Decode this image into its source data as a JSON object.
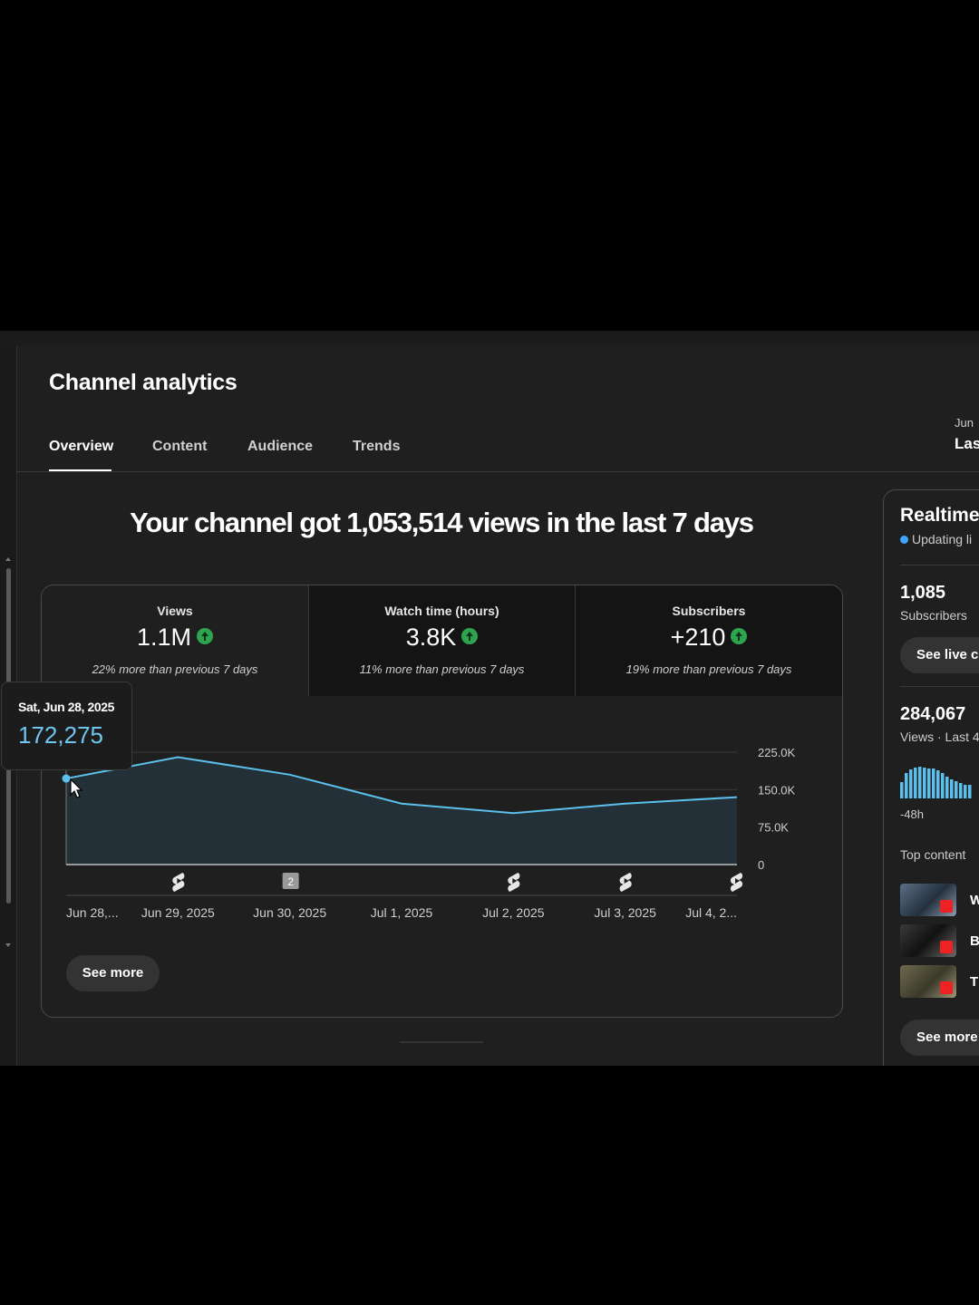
{
  "header": {
    "title": "Channel analytics",
    "tabs": [
      {
        "label": "Overview",
        "active": true
      },
      {
        "label": "Content",
        "active": false
      },
      {
        "label": "Audience",
        "active": false
      },
      {
        "label": "Trends",
        "active": false
      }
    ],
    "date_small": "Jun",
    "date_big": "Las"
  },
  "headline": "Your channel got 1,053,514 views in the last 7 days",
  "metrics": [
    {
      "label": "Views",
      "value": "1.1M",
      "trend": "up",
      "sub": "22% more than previous 7 days"
    },
    {
      "label": "Watch time (hours)",
      "value": "3.8K",
      "trend": "up",
      "sub": "11% more than previous 7 days"
    },
    {
      "label": "Subscribers",
      "value": "+210",
      "trend": "up",
      "sub": "19% more than previous 7 days"
    }
  ],
  "tooltip": {
    "date": "Sat, Jun 28, 2025",
    "value": "172,275"
  },
  "chart_data": {
    "type": "area",
    "x": [
      "Jun 28,...",
      "Jun 29, 2025",
      "Jun 30, 2025",
      "Jul 1, 2025",
      "Jul 2, 2025",
      "Jul 3, 2025",
      "Jul 4, 2..."
    ],
    "series": [
      {
        "values": [
          172275,
          215000,
          180000,
          122000,
          103000,
          122000,
          135000
        ]
      }
    ],
    "yticks": [
      "225.0K",
      "150.0K",
      "75.0K",
      "0"
    ],
    "ylim": [
      0,
      225000
    ],
    "line_color": "#5bc0eb",
    "fill_color": "#243038",
    "grid": true,
    "markers": [
      {
        "x_index": 1,
        "kind": "shorts-icon"
      },
      {
        "x_index": 2,
        "kind": "count-badge",
        "label": "2"
      },
      {
        "x_index": 4,
        "kind": "shorts-icon"
      },
      {
        "x_index": 5,
        "kind": "shorts-icon"
      },
      {
        "x_index": 6,
        "kind": "shorts-icon"
      }
    ]
  },
  "see_more_label": "See more",
  "realtime": {
    "title": "Realtime",
    "live_text": "Updating li",
    "subscribers": "1,085",
    "subscribers_label": "Subscribers",
    "see_live_label": "See live c",
    "views": "284,067",
    "views_label": "Views · Last 4",
    "range_label": "-48h",
    "top_content_label": "Top content",
    "top_items": [
      {
        "title": "W"
      },
      {
        "title": "B"
      },
      {
        "title": "T"
      }
    ],
    "see_more_label": "See more"
  }
}
